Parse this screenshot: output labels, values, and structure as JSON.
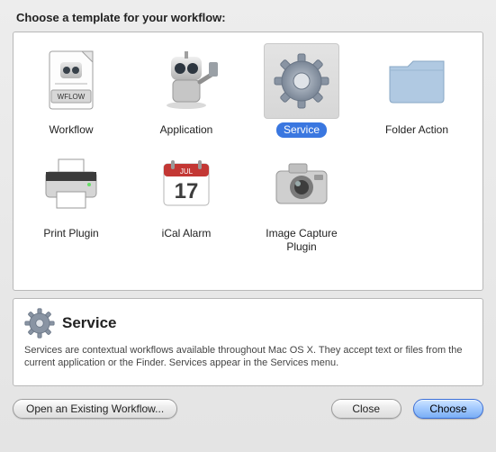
{
  "heading": "Choose a template for your workflow:",
  "templates": [
    {
      "label": "Workflow",
      "type": "workflow",
      "selected": false
    },
    {
      "label": "Application",
      "type": "application",
      "selected": false
    },
    {
      "label": "Service",
      "type": "service",
      "selected": true
    },
    {
      "label": "Folder Action",
      "type": "folder",
      "selected": false
    },
    {
      "label": "Print Plugin",
      "type": "printer",
      "selected": false
    },
    {
      "label": "iCal Alarm",
      "type": "ical",
      "selected": false
    },
    {
      "label": "Image Capture Plugin",
      "type": "camera",
      "selected": false
    }
  ],
  "info": {
    "title": "Service",
    "body": "Services are contextual workflows available throughout Mac OS X. They accept text or files from the current application or the Finder. Services appear in the Services menu."
  },
  "footer": {
    "open": "Open an Existing Workflow...",
    "close": "Close",
    "choose": "Choose"
  }
}
